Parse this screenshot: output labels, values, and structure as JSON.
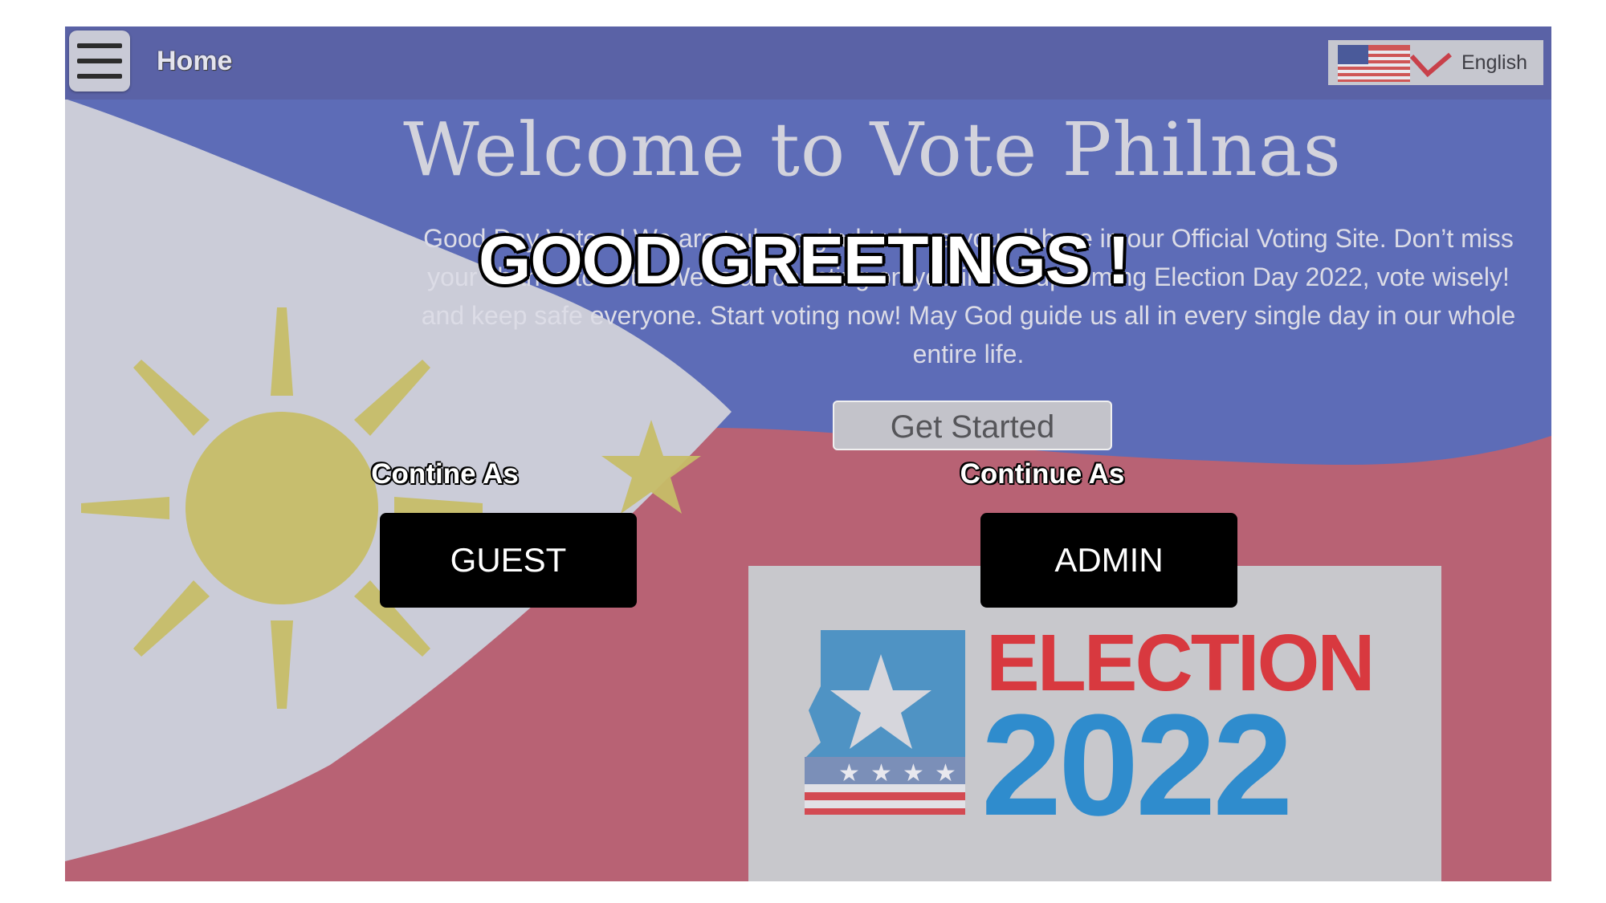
{
  "header": {
    "home_title": "Home",
    "language_label": "English",
    "menu_icon": "hamburger-menu-icon",
    "flag_icon": "us-flag-icon"
  },
  "hero": {
    "welcome_title": "Welcome to Vote Philnas",
    "intro_text": "Good Day Voters! We are truly so glad to have you all here in our Official Voting Site. Don’t miss your chance to vote. We’re all counting on you in this upcoming Election Day 2022, vote wisely! and keep safe everyone. Start voting now! May God guide us all in every single day in our whole entire life.",
    "get_started_label": "Get Started"
  },
  "overlay": {
    "greeting": "GOOD GREETINGS !",
    "guest_caption": "Contine As",
    "guest_button": "GUEST",
    "admin_caption": "Continue As",
    "admin_button": "ADMIN"
  },
  "election_badge": {
    "word": "ELECTION",
    "year": "2022"
  },
  "colors": {
    "topbar": "#5a62a6",
    "flag_blue": "#3a52b4",
    "flag_red": "#cc3a4a",
    "sun_yellow": "#e2c93a",
    "election_red": "#d8393f",
    "election_blue": "#2f8ccd"
  }
}
